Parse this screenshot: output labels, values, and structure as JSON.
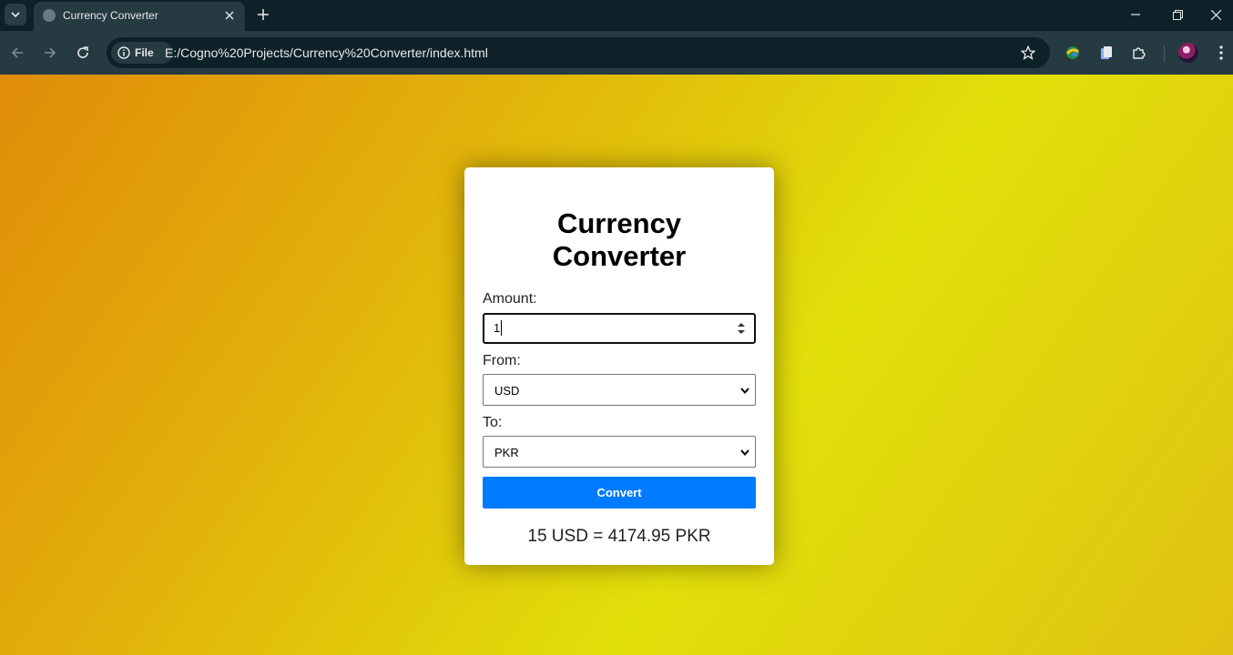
{
  "browser": {
    "tab_title": "Currency Converter",
    "site_chip_label": "File",
    "url": "E:/Cogno%20Projects/Currency%20Converter/index.html"
  },
  "page": {
    "title_line1": "Currency",
    "title_line2": "Converter",
    "amount_label": "Amount:",
    "amount_value": "1",
    "from_label": "From:",
    "from_value": "USD",
    "to_label": "To:",
    "to_value": "PKR",
    "convert_label": "Convert",
    "result_text": "15 USD = 4174.95 PKR"
  },
  "colors": {
    "accent_button": "#007bff",
    "card_background": "#ffffff",
    "gradient_start": "#e08c08",
    "gradient_end": "#e1df0a"
  }
}
